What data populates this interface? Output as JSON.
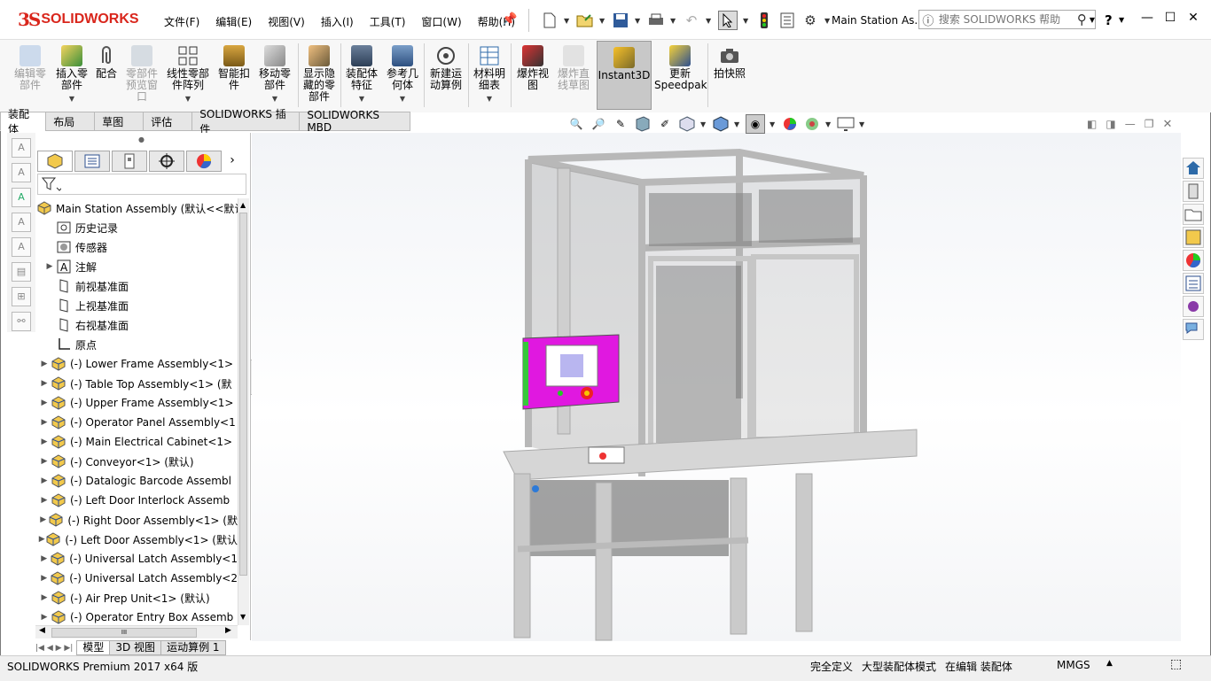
{
  "app": {
    "logo_prefix": "3S",
    "logo_name": "SOLIDWORKS",
    "document_title": "Main Station As...",
    "help_label": "?",
    "search_placeholder": "搜索 SOLIDWORKS 帮助"
  },
  "menu": [
    "文件(F)",
    "编辑(E)",
    "视图(V)",
    "插入(I)",
    "工具(T)",
    "窗口(W)",
    "帮助(H)"
  ],
  "command_manager": {
    "buttons": [
      {
        "label": "编辑零\n部件",
        "enabled": false
      },
      {
        "label": "插入零\n部件",
        "enabled": true
      },
      {
        "label": "配合",
        "enabled": true
      },
      {
        "label": "零部件\n预览窗\n口",
        "enabled": false
      },
      {
        "label": "线性零部\n件阵列",
        "enabled": true
      },
      {
        "label": "智能扣\n件",
        "enabled": true
      },
      {
        "label": "移动零\n部件",
        "enabled": true
      },
      {
        "label": "显示隐\n藏的零\n部件",
        "enabled": true
      },
      {
        "label": "装配体\n特征",
        "enabled": true
      },
      {
        "label": "参考几\n何体",
        "enabled": true
      },
      {
        "label": "新建运\n动算例",
        "enabled": true
      },
      {
        "label": "材料明\n细表",
        "enabled": true
      },
      {
        "label": "爆炸视\n图",
        "enabled": true
      },
      {
        "label": "爆炸直\n线草图",
        "enabled": false
      },
      {
        "label": "Instant3D",
        "enabled": true
      },
      {
        "label": "更新\nSpeedpak",
        "enabled": true
      },
      {
        "label": "拍快照",
        "enabled": true
      }
    ]
  },
  "tabs": [
    {
      "label": "装配体",
      "active": true
    },
    {
      "label": "布局",
      "active": false
    },
    {
      "label": "草图",
      "active": false
    },
    {
      "label": "评估",
      "active": false
    },
    {
      "label": "SOLIDWORKS 插件",
      "active": false
    },
    {
      "label": "SOLIDWORKS MBD",
      "active": false
    }
  ],
  "feature_tree": {
    "root": "Main Station Assembly  (默认<<默认",
    "items": [
      {
        "label": "历史记录",
        "icon": "history-icon",
        "expandable": false
      },
      {
        "label": "传感器",
        "icon": "sensor-icon",
        "expandable": false
      },
      {
        "label": "注解",
        "icon": "annotation-icon",
        "expandable": true
      },
      {
        "label": "前视基准面",
        "icon": "plane-icon",
        "expandable": false
      },
      {
        "label": "上视基准面",
        "icon": "plane-icon",
        "expandable": false
      },
      {
        "label": "右视基准面",
        "icon": "plane-icon",
        "expandable": false
      },
      {
        "label": "原点",
        "icon": "origin-icon",
        "expandable": false
      },
      {
        "label": "(-) Lower Frame Assembly<1>",
        "icon": "subassembly-icon",
        "expandable": true
      },
      {
        "label": "(-) Table Top Assembly<1> (默",
        "icon": "subassembly-icon",
        "expandable": true
      },
      {
        "label": "(-) Upper Frame Assembly<1>",
        "icon": "subassembly-icon",
        "expandable": true
      },
      {
        "label": "(-) Operator Panel Assembly<1",
        "icon": "subassembly-icon",
        "expandable": true
      },
      {
        "label": "(-) Main Electrical Cabinet<1>",
        "icon": "subassembly-icon",
        "expandable": true
      },
      {
        "label": "(-) Conveyor<1> (默认)",
        "icon": "subassembly-icon",
        "expandable": true
      },
      {
        "label": "(-) Datalogic Barcode Assembl",
        "icon": "subassembly-icon",
        "expandable": true
      },
      {
        "label": "(-) Left Door Interlock Assemb",
        "icon": "subassembly-icon",
        "expandable": true
      },
      {
        "label": "(-) Right Door Assembly<1> (默",
        "icon": "subassembly-icon",
        "expandable": true
      },
      {
        "label": "(-) Left Door Assembly<1> (默认",
        "icon": "subassembly-icon",
        "expandable": true
      },
      {
        "label": "(-) Universal Latch Assembly<1",
        "icon": "subassembly-icon",
        "expandable": true
      },
      {
        "label": "(-) Universal Latch Assembly<2",
        "icon": "subassembly-icon",
        "expandable": true
      },
      {
        "label": "(-) Air Prep Unit<1> (默认)",
        "icon": "subassembly-icon",
        "expandable": true
      },
      {
        "label": "(-) Operator Entry Box Assemb",
        "icon": "subassembly-icon",
        "expandable": true
      }
    ]
  },
  "hscroll_label": "III",
  "bottom_tabs": [
    {
      "label": "模型",
      "active": true
    },
    {
      "label": "3D 视图",
      "active": false
    },
    {
      "label": "运动算例 1",
      "active": false
    }
  ],
  "status": {
    "product": "SOLIDWORKS Premium 2017 x64 版",
    "state": "完全定义",
    "mode": "大型装配体模式",
    "editing": "在编辑 装配体",
    "units": "MMGS"
  },
  "colors": {
    "brand_red": "#d9261c",
    "frame_gray": "#c9c9c9",
    "panel_magenta": "#e018e0"
  }
}
